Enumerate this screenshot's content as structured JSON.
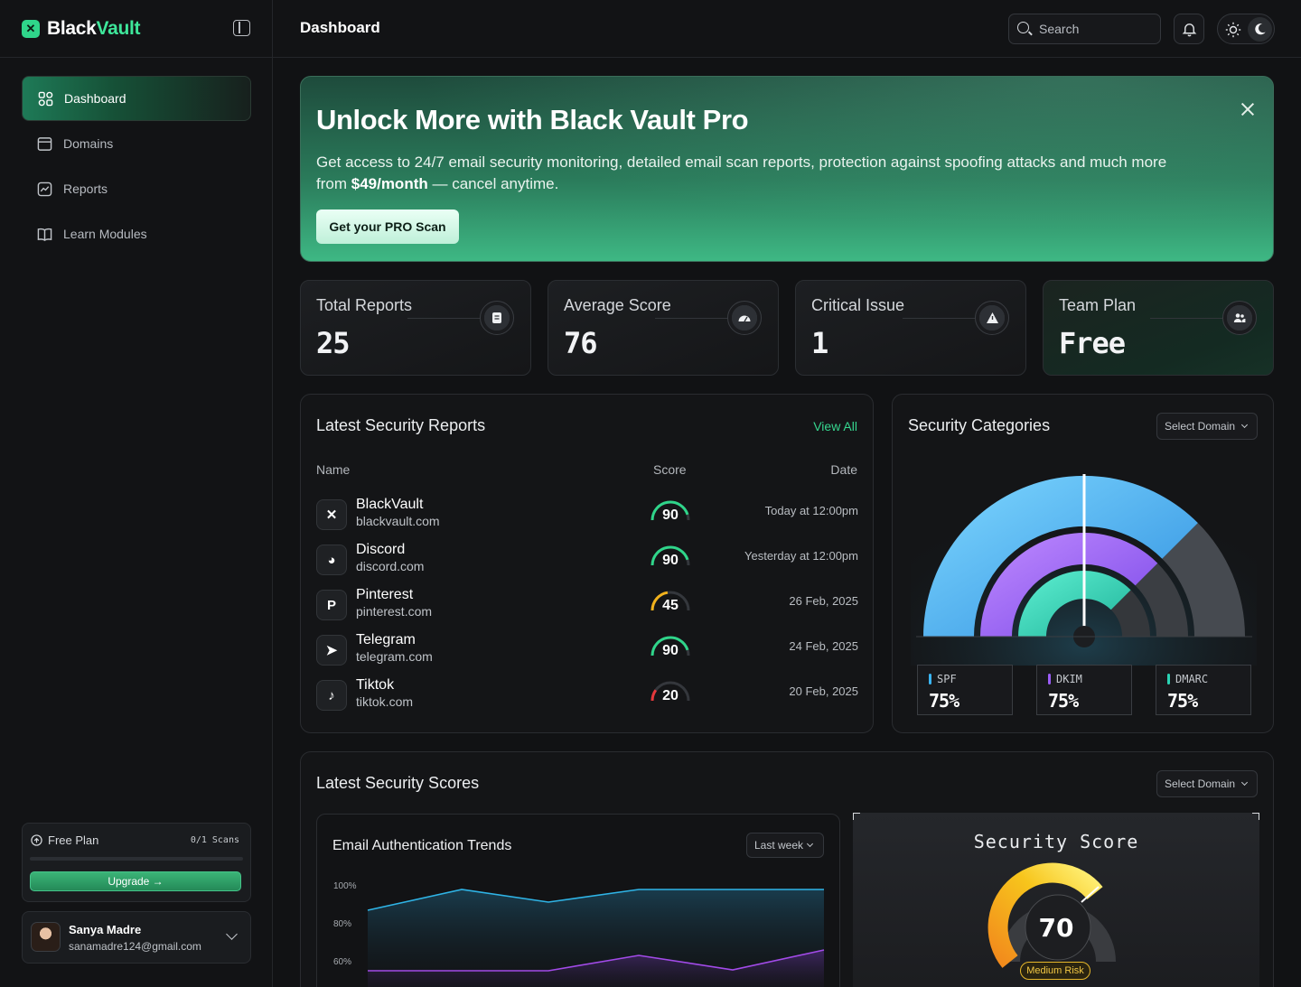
{
  "brand": {
    "name_part1": "Black",
    "name_part2": "Vault",
    "logo_letter": "✕"
  },
  "sidebar": {
    "items": [
      {
        "label": "Dashboard",
        "icon": "grid-icon",
        "active": true
      },
      {
        "label": "Domains",
        "icon": "browser-window-icon",
        "active": false
      },
      {
        "label": "Reports",
        "icon": "chart-line-icon",
        "active": false
      },
      {
        "label": "Learn Modules",
        "icon": "book-icon",
        "active": false
      }
    ],
    "plan": {
      "title": "Free Plan",
      "scans": "0/1 Scans",
      "progress": 0,
      "upgrade_label": "Upgrade →"
    },
    "user": {
      "name": "Sanya Madre",
      "email": "sanamadre124@gmail.com"
    }
  },
  "header": {
    "title": "Dashboard",
    "search_placeholder": "Search"
  },
  "banner": {
    "title": "Unlock More with Black Vault Pro",
    "text_before": "Get access to 24/7 email security monitoring, detailed email scan reports, protection against spoofing attacks and much more from ",
    "price": "$49/month",
    "text_after": " — cancel anytime.",
    "button": "Get your PRO Scan"
  },
  "stats": [
    {
      "label": "Total Reports",
      "value": "25",
      "icon": "document-icon"
    },
    {
      "label": "Average Score",
      "value": "76",
      "icon": "speedometer-icon"
    },
    {
      "label": "Critical Issue",
      "value": "1",
      "icon": "warning-triangle-icon"
    },
    {
      "label": "Team Plan",
      "value": "Free",
      "icon": "users-icon"
    }
  ],
  "reports": {
    "title": "Latest Security Reports",
    "view_all": "View All",
    "columns": {
      "name": "Name",
      "score": "Score",
      "date": "Date"
    },
    "rows": [
      {
        "name": "BlackVault",
        "domain": "blackvault.com",
        "score": 90,
        "date": "Today at 12:00pm",
        "icon": "✕",
        "color": "#2fd58a"
      },
      {
        "name": "Discord",
        "domain": "discord.com",
        "score": 90,
        "date": "Yesterday at 12:00pm",
        "icon": "◕",
        "color": "#2fd58a"
      },
      {
        "name": "Pinterest",
        "domain": "pinterest.com",
        "score": 45,
        "date": "26 Feb, 2025",
        "icon": "P",
        "color": "#f2b21c"
      },
      {
        "name": "Telegram",
        "domain": "telegram.com",
        "score": 90,
        "date": "24 Feb, 2025",
        "icon": "➤",
        "color": "#2fd58a"
      },
      {
        "name": "Tiktok",
        "domain": "tiktok.com",
        "score": 20,
        "date": "20 Feb, 2025",
        "icon": "♪",
        "color": "#e5383b"
      }
    ]
  },
  "categories": {
    "title": "Security Categories",
    "select": "Select Domain",
    "items": [
      {
        "name": "SPF",
        "value": "75%",
        "color": "#3ab4f2"
      },
      {
        "name": "DKIM",
        "value": "75%",
        "color": "#9b5cf6"
      },
      {
        "name": "DMARC",
        "value": "75%",
        "color": "#2ad3b4"
      }
    ]
  },
  "scores": {
    "title": "Latest Security Scores",
    "select": "Select Domain",
    "trend": {
      "title": "Email Authentication Trends",
      "range": "Last week",
      "y_ticks": [
        "100%",
        "80%",
        "60%"
      ]
    },
    "gauge": {
      "title": "Security Score",
      "value": "70",
      "risk": "Medium Risk"
    }
  }
}
